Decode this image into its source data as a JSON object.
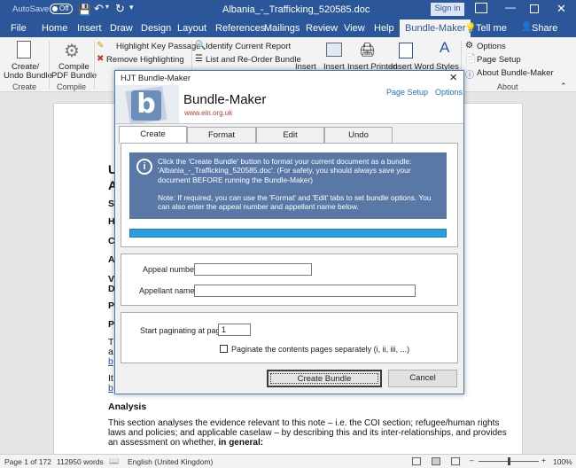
{
  "titlebar": {
    "autosave_label": "AutoSave",
    "autosave_state": "Off",
    "document_title": "Albania_-_Trafficking_520585.doc",
    "sign_in": "Sign in"
  },
  "ribbon_tabs": [
    "File",
    "Home",
    "Insert",
    "Draw",
    "Design",
    "Layout",
    "References",
    "Mailings",
    "Review",
    "View",
    "Help",
    "Bundle-Maker"
  ],
  "tell_me": "Tell me",
  "share": "Share",
  "ribbon": {
    "create_undo_bundle": [
      "Create/",
      "Undo Bundle"
    ],
    "create_group": "Create",
    "compile_pdf": [
      "Compile",
      "PDF Bundle"
    ],
    "compile_group": "Compile",
    "highlight_key_passage": "Highlight Key Passage",
    "remove_highlighting": "Remove Highlighting",
    "identify_current_report": "Identify Current Report",
    "list_reorder_bundle": "List and Re-Order Bundle",
    "insert_1": "Insert",
    "insert_2": "Insert",
    "insert_printed": "Insert Printed",
    "insert_word": "Insert Word",
    "styles": "Styles",
    "options": "Options",
    "page_setup": "Page Setup",
    "about": "About Bundle-Maker",
    "about_group": "About"
  },
  "document": {
    "peek_lines": [
      "U",
      "A",
      "S",
      "H",
      "C",
      "A",
      "V",
      "D",
      "P",
      "P",
      "T",
      "a",
      "b",
      "It",
      "b"
    ],
    "analysis_heading": "Analysis",
    "para_line1": "This section analyses the evidence relevant to this note – i.e. the COI section; refugee/human rights",
    "para_line2": "laws and policies; and applicable caselaw – by describing this and its inter-relationships, and provides",
    "para_line3_a": "an assessment on whether, ",
    "para_line3_b": "in general:"
  },
  "statusbar": {
    "page": "Page 1 of 172",
    "words": "112950 words",
    "language": "English (United Kingdom)",
    "zoom": "100%"
  },
  "dialog": {
    "title": "HJT Bundle-Maker",
    "app_name": "Bundle-Maker",
    "url": "www.ein.org.uk",
    "page_setup_link": "Page Setup",
    "options_link": "Options",
    "tabs": [
      "Create",
      "Format",
      "Edit",
      "Undo"
    ],
    "info_lines": [
      "Click the 'Create Bundle' button to format your current document as a bundle:",
      "'Albania_-_Trafficking_520585.doc'. (For safety, you should always save your",
      "document BEFORE running the Bundle-Maker)",
      "",
      "Note: If required, you can use the 'Format' and 'Edit' tabs to set bundle options. You",
      "can also enter the appeal number and appellant name below."
    ],
    "appeal_number_label": "Appeal number:",
    "appeal_number_value": "",
    "appellant_name_label": "Appellant name:",
    "appellant_name_value": "",
    "start_paginating_label": "Start paginating at page:",
    "start_page_value": "1",
    "paginate_contents_label": "Paginate the contents pages separately (i, ii, iii, ...)",
    "paginate_contents_checked": false,
    "create_button": "Create Bundle",
    "cancel_button": "Cancel"
  },
  "colors": {
    "word_blue": "#2b579a",
    "info_panel": "#5a78a6",
    "progress": "#2c9de0",
    "link": "#1f6fc5",
    "url_red": "#c0392b"
  }
}
